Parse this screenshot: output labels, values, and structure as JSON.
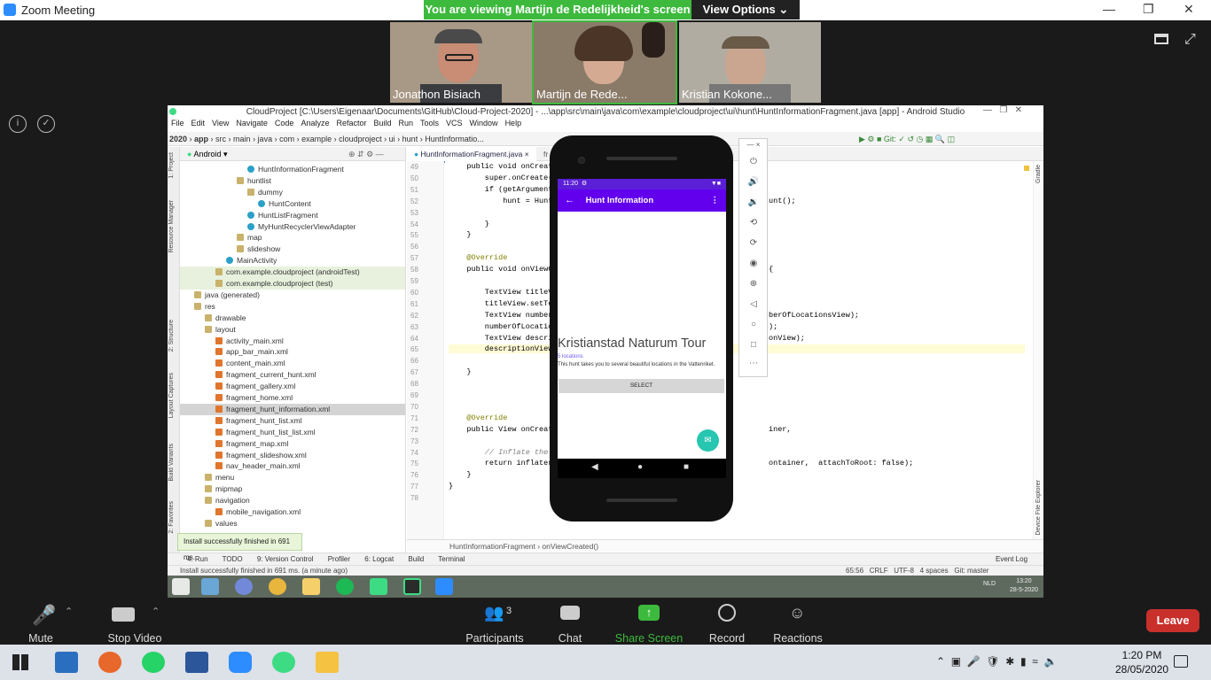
{
  "zoom": {
    "window_title": "Zoom Meeting",
    "viewing_banner": "You are viewing Martijn de Redelijkheid's screen",
    "view_options_label": "View Options",
    "participants_videos": [
      {
        "name": "Jonathon Bisiach"
      },
      {
        "name": "Martijn de Rede..."
      },
      {
        "name": "Kristian Kokone..."
      }
    ],
    "controls": {
      "mute": "Mute",
      "stop_video": "Stop Video",
      "participants": "Participants",
      "participants_count": "3",
      "chat": "Chat",
      "share_screen": "Share Screen",
      "record": "Record",
      "reactions": "Reactions",
      "leave": "Leave"
    }
  },
  "android_studio": {
    "title": "CloudProject [C:\\Users\\Eigenaar\\Documents\\GitHub\\Cloud-Project-2020] - ...\\app\\src\\main\\java\\com\\example\\cloudproject\\ui\\hunt\\HuntInformationFragment.java [app] - Android Studio",
    "menu": [
      "File",
      "Edit",
      "View",
      "Navigate",
      "Code",
      "Analyze",
      "Refactor",
      "Build",
      "Run",
      "Tools",
      "VCS",
      "Window",
      "Help"
    ],
    "nav_path": [
      "2020",
      "app",
      "src",
      "main",
      "java",
      "com",
      "example",
      "cloudproject",
      "ui",
      "hunt",
      "HuntInformatio..."
    ],
    "project_view": "Android",
    "tree": [
      {
        "label": "HuntInformationFragment",
        "type": "class",
        "indent": 6,
        "cls": ""
      },
      {
        "label": "huntlist",
        "type": "folder",
        "indent": 5,
        "cls": ""
      },
      {
        "label": "dummy",
        "type": "folder",
        "indent": 6,
        "cls": ""
      },
      {
        "label": "HuntContent",
        "type": "class",
        "indent": 7,
        "cls": ""
      },
      {
        "label": "HuntListFragment",
        "type": "class",
        "indent": 6,
        "cls": ""
      },
      {
        "label": "MyHuntRecyclerViewAdapter",
        "type": "class",
        "indent": 6,
        "cls": ""
      },
      {
        "label": "map",
        "type": "folder",
        "indent": 5,
        "cls": ""
      },
      {
        "label": "slideshow",
        "type": "folder",
        "indent": 5,
        "cls": ""
      },
      {
        "label": "MainActivity",
        "type": "class",
        "indent": 4,
        "cls": ""
      },
      {
        "label": "com.example.cloudproject (androidTest)",
        "type": "folder",
        "indent": 3,
        "cls": "hl"
      },
      {
        "label": "com.example.cloudproject (test)",
        "type": "folder",
        "indent": 3,
        "cls": "hl"
      },
      {
        "label": "java (generated)",
        "type": "folder",
        "indent": 1,
        "cls": ""
      },
      {
        "label": "res",
        "type": "folder",
        "indent": 1,
        "cls": ""
      },
      {
        "label": "drawable",
        "type": "folder",
        "indent": 2,
        "cls": ""
      },
      {
        "label": "layout",
        "type": "folder",
        "indent": 2,
        "cls": ""
      },
      {
        "label": "activity_main.xml",
        "type": "xml",
        "indent": 3,
        "cls": ""
      },
      {
        "label": "app_bar_main.xml",
        "type": "xml",
        "indent": 3,
        "cls": ""
      },
      {
        "label": "content_main.xml",
        "type": "xml",
        "indent": 3,
        "cls": ""
      },
      {
        "label": "fragment_current_hunt.xml",
        "type": "xml",
        "indent": 3,
        "cls": ""
      },
      {
        "label": "fragment_gallery.xml",
        "type": "xml",
        "indent": 3,
        "cls": ""
      },
      {
        "label": "fragment_home.xml",
        "type": "xml",
        "indent": 3,
        "cls": ""
      },
      {
        "label": "fragment_hunt_information.xml",
        "type": "xml",
        "indent": 3,
        "cls": "sel"
      },
      {
        "label": "fragment_hunt_list.xml",
        "type": "xml",
        "indent": 3,
        "cls": ""
      },
      {
        "label": "fragment_hunt_list_list.xml",
        "type": "xml",
        "indent": 3,
        "cls": ""
      },
      {
        "label": "fragment_map.xml",
        "type": "xml",
        "indent": 3,
        "cls": ""
      },
      {
        "label": "fragment_slideshow.xml",
        "type": "xml",
        "indent": 3,
        "cls": ""
      },
      {
        "label": "nav_header_main.xml",
        "type": "xml",
        "indent": 3,
        "cls": ""
      },
      {
        "label": "menu",
        "type": "folder",
        "indent": 2,
        "cls": ""
      },
      {
        "label": "mipmap",
        "type": "folder",
        "indent": 2,
        "cls": ""
      },
      {
        "label": "navigation",
        "type": "folder",
        "indent": 2,
        "cls": ""
      },
      {
        "label": "mobile_navigation.xml",
        "type": "xml",
        "indent": 3,
        "cls": ""
      },
      {
        "label": "values",
        "type": "folder",
        "indent": 2,
        "cls": ""
      }
    ],
    "editor_tab": "HuntInformationFragment.java",
    "editor_tab2": "fr",
    "line_numbers": [
      "49",
      "50",
      "51",
      "52",
      "53",
      "54",
      "55",
      "56",
      "57",
      "58",
      "59",
      "60",
      "61",
      "62",
      "63",
      "64",
      "65",
      "66",
      "67",
      "68",
      "69",
      "70",
      "71",
      "72",
      "73",
      "74",
      "75",
      "76",
      "77",
      "78"
    ],
    "code_lines": [
      "    public void onCreate(",
      "        super.onCreate(sa",
      "        if (getArguments(",
      "            hunt = HuntI",
      "",
      "        }",
      "    }",
      "",
      "    @Override",
      "    public void onViewCre",
      "",
      "        TextView titleVie",
      "        titleView.setText",
      "        TextView numberOf",
      "        numberOfLocations",
      "        TextView descript",
      "        descriptionView.s",
      "",
      "    }",
      "",
      "",
      "",
      "    @Override",
      "    public View onCreateV",
      "",
      "        // Inflate the La",
      "        return inflater.i",
      "    }",
      "}",
      ""
    ],
    "code_right": [
      {
        "line": 3,
        "text": "unt();"
      },
      {
        "line": 9,
        "text": "{"
      },
      {
        "line": 13,
        "text": "berOfLocationsView);"
      },
      {
        "line": 14,
        "text": ");"
      },
      {
        "line": 15,
        "text": "onView);"
      },
      {
        "line": 23,
        "text": "iner,"
      },
      {
        "line": 26,
        "text": "ontainer,  attachToRoot: false);"
      }
    ],
    "breadcrumb": [
      "HuntInformationFragment",
      "onViewCreated()"
    ],
    "bottom_tabs": [
      "4: Run",
      "TODO",
      "9: Version Control",
      "Profiler",
      "6: Logcat",
      "Build",
      "Terminal"
    ],
    "event_log": "Event Log",
    "status_message": "Install successfully finished in 691 ms. (a minute ago)",
    "toast": "Install successfully finished in 691 ms.",
    "status_right": [
      "65:56",
      "CRLF",
      "UTF-8",
      "4 spaces",
      "Git: master"
    ],
    "side_tabs_left": [
      "1: Project",
      "Resource Manager",
      "2: Structure",
      "Layout Captures",
      "Build Variants",
      "2: Favorites"
    ],
    "side_tabs_right": [
      "Gradle",
      "Device File Explorer"
    ],
    "inner_clock": "13:20",
    "inner_date": "28-5-2020",
    "inner_lang": "NLD"
  },
  "emulator": {
    "status_time": "11:20",
    "app_title": "Hunt Information",
    "hunt_title": "Kristianstad Naturum Tour",
    "locations": "5 locations",
    "description": "This hunt takes you to several beautiful locations in the Vattenriket.",
    "select_button": "SELECT",
    "accent": "#6200ee",
    "fab_color": "#26c6b0"
  },
  "windows": {
    "clock_time": "1:20 PM",
    "clock_date": "28/05/2020"
  }
}
